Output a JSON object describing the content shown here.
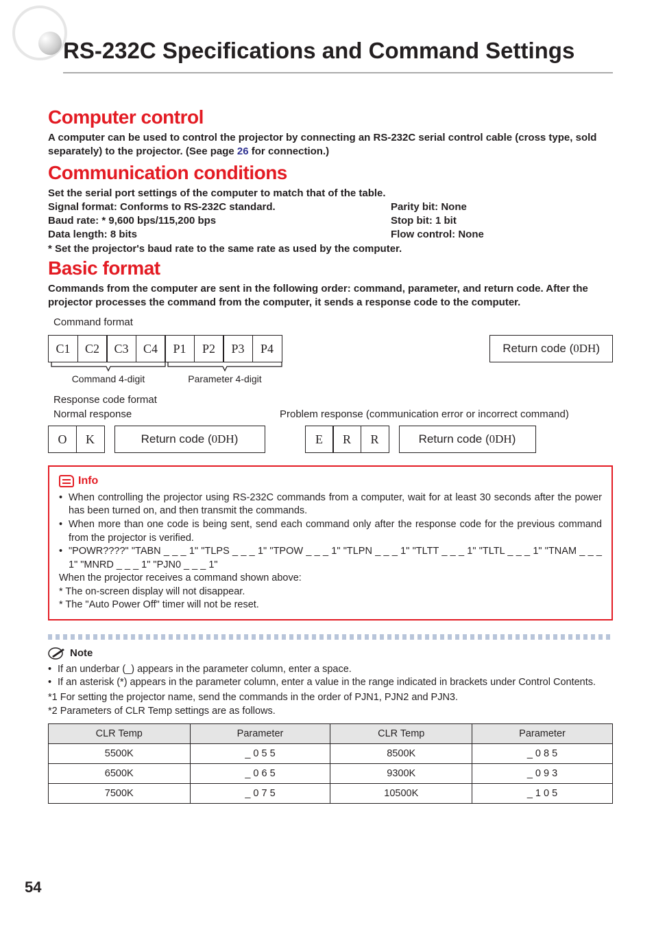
{
  "mainTitle": "RS-232C Specifications and Command Settings",
  "sections": {
    "computerControl": {
      "title": "Computer control",
      "body_pre": "A computer can be used to control the projector by connecting an RS-232C serial control cable (cross type, sold separately) to the projector. (See page ",
      "pageRef": "26",
      "body_post": " for connection.)"
    },
    "commConditions": {
      "title": "Communication conditions",
      "intro": "Set the serial port settings of the computer to match that of the table.",
      "rows": [
        {
          "left": "Signal format: Conforms to RS-232C standard.",
          "right": "Parity bit: None"
        },
        {
          "left": "Baud rate: * 9,600 bps/115,200 bps",
          "right": "Stop bit: 1 bit"
        },
        {
          "left": "Data length: 8 bits",
          "right": "Flow control: None"
        }
      ],
      "footnote": "* Set the projector's baud rate to the same rate as used by the computer."
    },
    "basicFormat": {
      "title": "Basic format",
      "body": "Commands from the computer are sent in the following order: command, parameter, and return code. After the projector processes the command from the computer, it sends a response code to the computer.",
      "commandFormatLabel": "Command format",
      "cells": [
        "C1",
        "C2",
        "C3",
        "C4",
        "P1",
        "P2",
        "P3",
        "P4"
      ],
      "returnCodeLabel_pre": "Return code (",
      "returnCodeLabel_code": "0DH",
      "returnCodeLabel_post": ")",
      "brace1": "Command 4-digit",
      "brace2": "Parameter 4-digit",
      "responseFormatLabel": "Response code format",
      "normalLabel": "Normal response",
      "problemLabel": "Problem response (communication error or incorrect command)",
      "okCells": [
        "O",
        "K"
      ],
      "errCells": [
        "E",
        "R",
        "R"
      ]
    }
  },
  "info": {
    "title": "Info",
    "bullets": [
      "When controlling the projector using RS-232C commands from a computer, wait for at least 30 seconds after the power has been turned on, and then transmit the commands.",
      "When more than one code is being sent, send each command only after the response code for the previous command from the projector is verified.",
      "\"POWR????\" \"TABN _ _ _ 1\" \"TLPS _ _ _ 1\" \"TPOW _ _ _ 1\" \"TLPN _ _ _ 1\" \"TLTT _ _ _ 1\" \"TLTL _ _ _ 1\" \"TNAM _ _ _ 1\" \"MNRD _ _ _ 1\" \"PJN0 _ _ _ 1\""
    ],
    "plain": [
      "When the projector receives a command shown above:",
      "* The on-screen display will not disappear.",
      "* The \"Auto Power Off\" timer will not be reset."
    ]
  },
  "note": {
    "title": "Note",
    "bullets": [
      "If an underbar (_) appears in the parameter column, enter a space.",
      "If an asterisk (*) appears in the parameter column, enter a value in the range indicated in brackets under Control Contents."
    ],
    "footnotes": [
      "*1 For setting the projector name, send the commands in the order of PJN1, PJN2 and PJN3.",
      "*2 Parameters of CLR Temp settings are as follows."
    ]
  },
  "table": {
    "headers": [
      "CLR Temp",
      "Parameter",
      "CLR Temp",
      "Parameter"
    ],
    "rows": [
      [
        "5500K",
        "_ 0 5 5",
        "8500K",
        "_ 0 8 5"
      ],
      [
        "6500K",
        "_ 0 6 5",
        "9300K",
        "_ 0 9 3"
      ],
      [
        "7500K",
        "_ 0 7 5",
        "10500K",
        "_ 1 0 5"
      ]
    ]
  },
  "pageNumber": "54"
}
